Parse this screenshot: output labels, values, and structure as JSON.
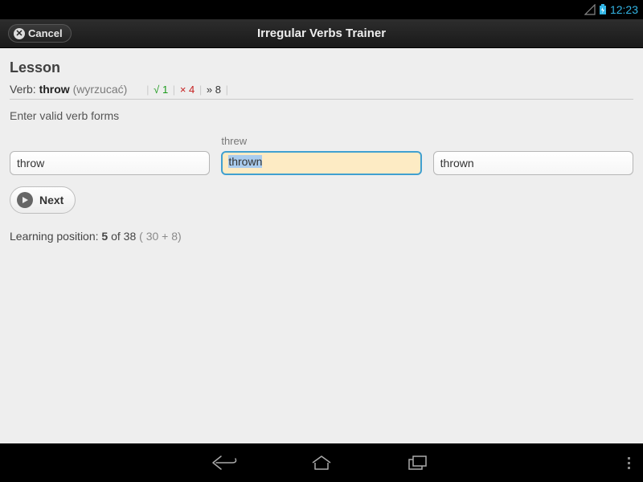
{
  "status": {
    "time": "12:23"
  },
  "actionbar": {
    "cancel": "Cancel",
    "title": "Irregular Verbs Trainer"
  },
  "lesson": {
    "heading": "Lesson",
    "verb_label": "Verb: ",
    "verb": "throw",
    "translation": "(wyrzucać)",
    "stats": {
      "ok_sym": "√",
      "ok": "1",
      "bad_sym": "×",
      "bad": "4",
      "rem_sym": "»",
      "rem": "8"
    },
    "instruction": "Enter valid verb forms",
    "hint_past": "threw",
    "input_inf": "throw",
    "input_past": "thrown",
    "input_pp": "thrown",
    "next": "Next",
    "pos_prefix": "Learning position: ",
    "pos_cur": "5",
    "pos_of": " of 38 ",
    "pos_detail": "( 30 + 8)"
  }
}
